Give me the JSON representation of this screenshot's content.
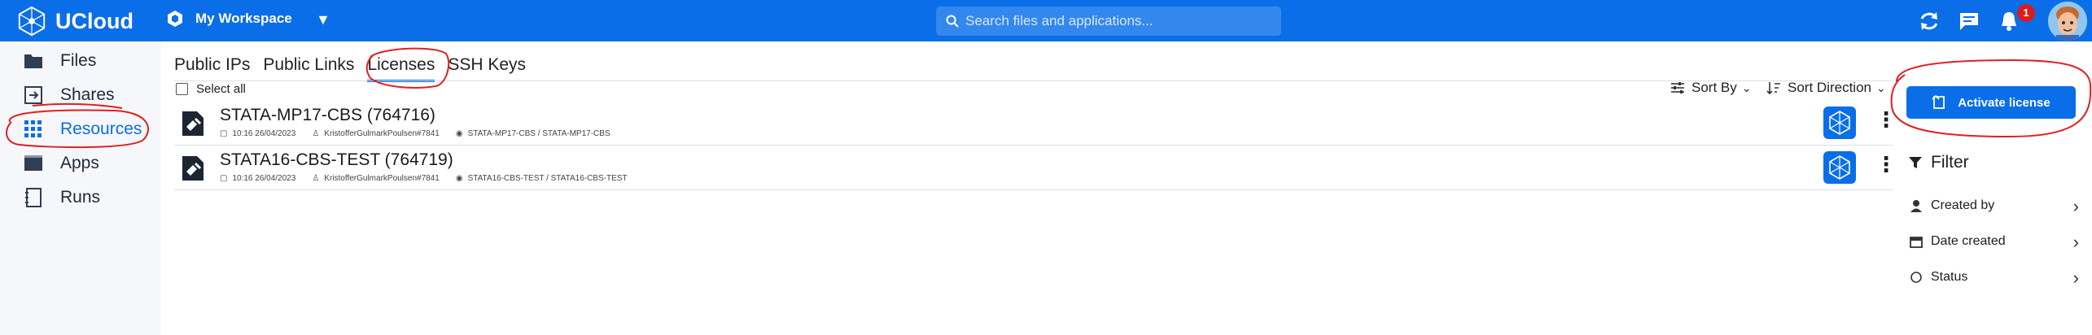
{
  "header": {
    "brand": "UCloud",
    "workspace": "My Workspace",
    "search_placeholder": "Search files and applications...",
    "notification_count": "1"
  },
  "sidebar": {
    "items": [
      {
        "label": "Files",
        "icon": "folder-icon"
      },
      {
        "label": "Shares",
        "icon": "shares-icon"
      },
      {
        "label": "Resources",
        "icon": "grid-icon",
        "active": true
      },
      {
        "label": "Apps",
        "icon": "apps-icon"
      },
      {
        "label": "Runs",
        "icon": "notebook-icon"
      }
    ]
  },
  "tabs": [
    "Public IPs",
    "Public Links",
    "Licenses",
    "SSH Keys"
  ],
  "active_tab": "Licenses",
  "list": {
    "select_all": "Select all",
    "sort_by": "Sort By",
    "sort_direction": "Sort Direction",
    "rows": [
      {
        "title": "STATA-MP17-CBS (764716)",
        "date": "10:16 26/04/2023",
        "owner": "KristofferGulmarkPoulsen#7841",
        "product": "STATA-MP17-CBS / STATA-MP17-CBS"
      },
      {
        "title": "STATA16-CBS-TEST (764719)",
        "date": "10:16 26/04/2023",
        "owner": "KristofferGulmarkPoulsen#7841",
        "product": "STATA16-CBS-TEST / STATA16-CBS-TEST"
      }
    ]
  },
  "right_panel": {
    "activate_label": "Activate license",
    "filter_label": "Filter",
    "filters": [
      "Created by",
      "Date created",
      "Status"
    ]
  },
  "colors": {
    "accent": "#0a6ee8",
    "annotation": "#e02020"
  }
}
